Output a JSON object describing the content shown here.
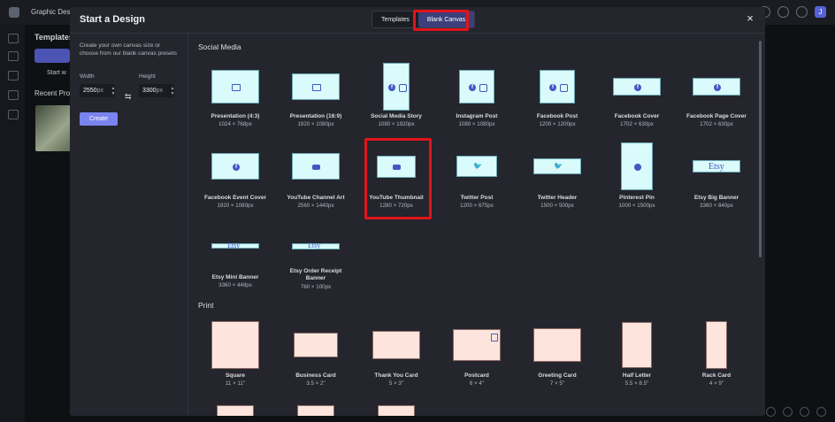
{
  "app": {
    "title": "Graphic Design",
    "sidebar_heading": "Templates",
    "start_label": "Start w",
    "recent_label": "Recent Pro",
    "avatar_letter": "J"
  },
  "modal": {
    "title": "Start a Design",
    "tabs": [
      {
        "label": "Templates",
        "active": false
      },
      {
        "label": "Blank Canvas",
        "active": true
      }
    ],
    "close_label": "×"
  },
  "left_panel": {
    "description": "Create your own canvas size or choose from our blank canvas presets",
    "width_label": "Width",
    "width_value": "2550",
    "height_label": "Height",
    "height_value": "3300",
    "unit": "px",
    "create_label": "Create"
  },
  "sections": {
    "social_title": "Social Media",
    "print_title": "Print"
  },
  "social": [
    {
      "name": "Presentation (4:3)",
      "dims": "1024 × 768px",
      "icon": "image-icon"
    },
    {
      "name": "Presentation (16:9)",
      "dims": "1920 × 1080px",
      "icon": "image-icon"
    },
    {
      "name": "Social Media Story",
      "dims": "1080 × 1920px",
      "icon": "facebook-instagram-icon"
    },
    {
      "name": "Instagram Post",
      "dims": "1080 × 1080px",
      "icon": "facebook-instagram-icon"
    },
    {
      "name": "Facebook Post",
      "dims": "1200 × 1200px",
      "icon": "facebook-instagram-icon"
    },
    {
      "name": "Facebook Cover",
      "dims": "1702 × 630px",
      "icon": "facebook-icon"
    },
    {
      "name": "Facebook Page Cover",
      "dims": "1702 × 630px",
      "icon": "facebook-icon"
    },
    {
      "name": "Facebook Event Cover",
      "dims": "1920 × 1080px",
      "icon": "facebook-icon"
    },
    {
      "name": "YouTube Channel Art",
      "dims": "2560 × 1440px",
      "icon": "youtube-icon"
    },
    {
      "name": "YouTube Thumbnail",
      "dims": "1280 × 720px",
      "icon": "youtube-icon"
    },
    {
      "name": "Twitter Post",
      "dims": "1200 × 675px",
      "icon": "twitter-icon"
    },
    {
      "name": "Twitter Header",
      "dims": "1500 × 500px",
      "icon": "twitter-icon"
    },
    {
      "name": "Pinterest Pin",
      "dims": "1000 × 1500px",
      "icon": "pinterest-icon"
    },
    {
      "name": "Etsy Big Banner",
      "dims": "3360 × 840px",
      "icon": "etsy-logo"
    },
    {
      "name": "Etsy Mini Banner",
      "dims": "3360 × 448px",
      "icon": "etsy-logo"
    },
    {
      "name": "Etsy Order Receipt Banner",
      "dims": "760 × 100px",
      "icon": "etsy-logo"
    }
  ],
  "print": [
    {
      "name": "Square",
      "dims": "11 × 11\""
    },
    {
      "name": "Business Card",
      "dims": "3.5 × 2\""
    },
    {
      "name": "Thank You Card",
      "dims": "5 × 3\""
    },
    {
      "name": "Postcard",
      "dims": "6 × 4\""
    },
    {
      "name": "Greeting Card",
      "dims": "7 × 5\""
    },
    {
      "name": "Half Letter",
      "dims": "5.5 × 8.5\""
    },
    {
      "name": "Rack Card",
      "dims": "4 × 9\""
    }
  ],
  "etsy_word": "Etsy",
  "colors": {
    "accent": "#7a84ee",
    "highlight": "#e0141b",
    "social_fill": "#d9fbfb",
    "print_fill": "#fde4dd"
  }
}
